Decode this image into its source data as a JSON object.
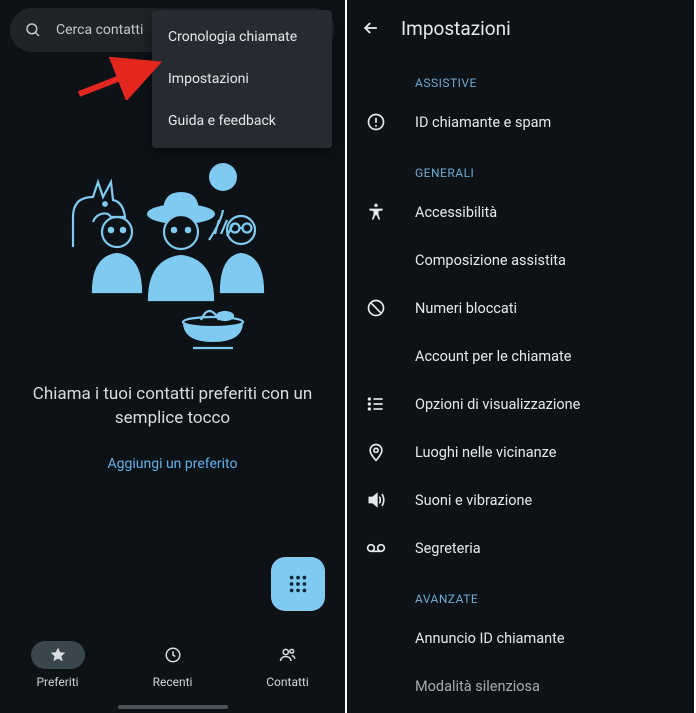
{
  "left": {
    "search_placeholder": "Cerca contatti",
    "menu": {
      "items": [
        {
          "label": "Cronologia chiamate"
        },
        {
          "label": "Impostazioni"
        },
        {
          "label": "Guida e feedback"
        }
      ]
    },
    "empty_title": "Chiama i tuoi contatti preferiti con un semplice tocco",
    "add_favorite": "Aggiungi un preferito",
    "nav": {
      "items": [
        {
          "label": "Preferiti"
        },
        {
          "label": "Recenti"
        },
        {
          "label": "Contatti"
        }
      ]
    }
  },
  "right": {
    "title": "Impostazioni",
    "sections": {
      "assistive": {
        "label": "ASSISTIVE"
      },
      "general": {
        "label": "GENERALI"
      },
      "advanced": {
        "label": "AVANZATE"
      }
    },
    "items": {
      "caller_id_spam": "ID chiamante e spam",
      "accessibility": "Accessibilità",
      "assisted_dial": "Composizione assistita",
      "blocked": "Numeri bloccati",
      "call_accounts": "Account per le chiamate",
      "display_opts": "Opzioni di visualizzazione",
      "nearby": "Luoghi nelle vicinanze",
      "sounds": "Suoni e vibrazione",
      "voicemail": "Segreteria",
      "announce_caller": "Annuncio ID chiamante",
      "silent_mode": "Modalità silenziosa"
    }
  },
  "colors": {
    "accent": "#7fcaf0",
    "link": "#63b0e8",
    "section": "#6fa8d2",
    "arrow": "#e3261e"
  }
}
